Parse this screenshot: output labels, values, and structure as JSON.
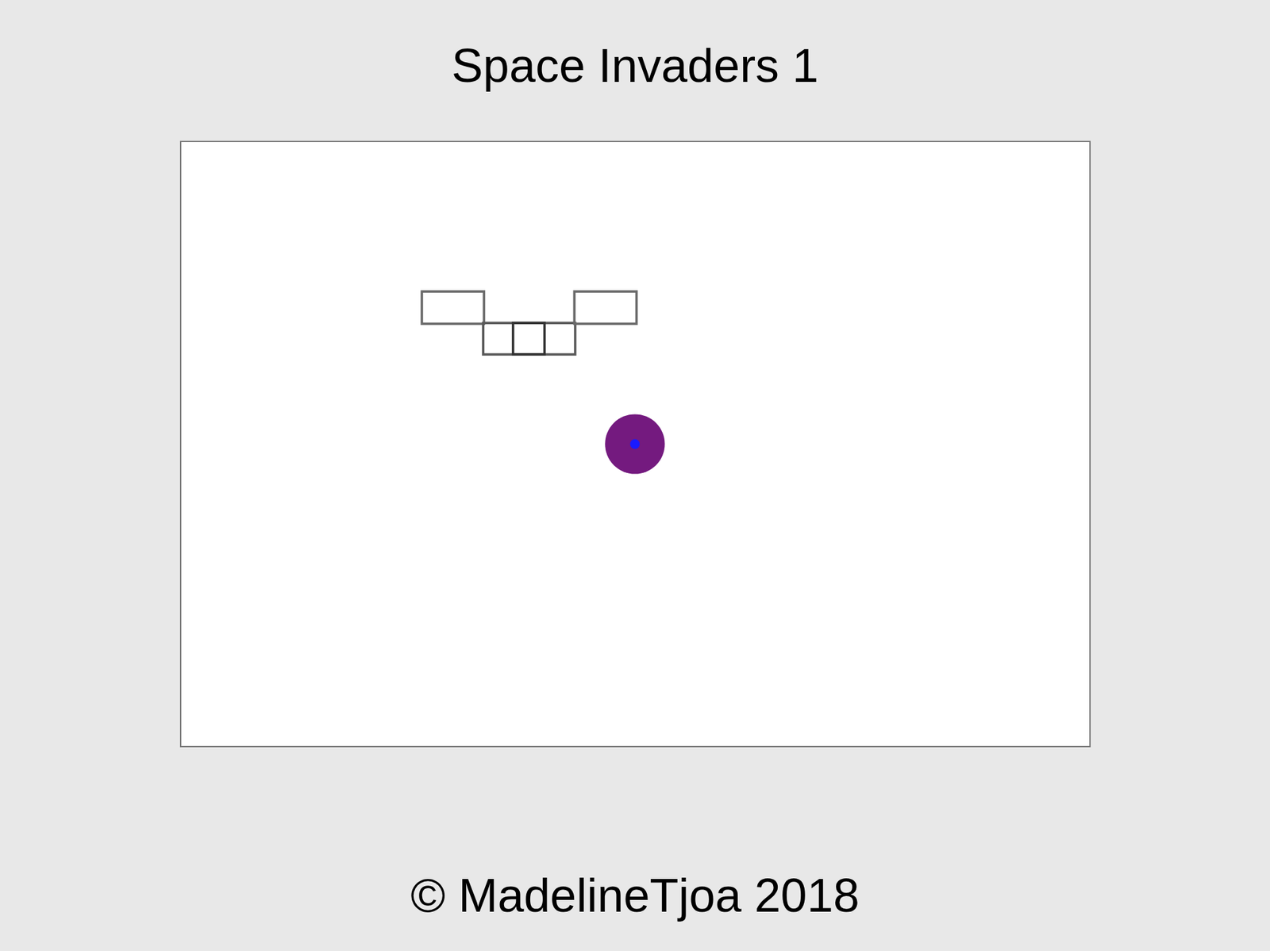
{
  "title": "Space Invaders 1",
  "footer": "© MadelineTjoa 2018"
}
